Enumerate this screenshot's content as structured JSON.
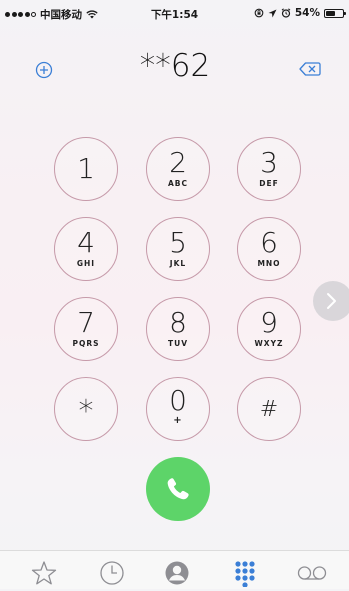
{
  "status_bar": {
    "carrier": "中国移动",
    "time": "下午1:54",
    "battery_percent": "54%",
    "battery_level": 0.54,
    "signal_bars_filled": 4,
    "signal_bars_total": 5,
    "icons": [
      "wifi-icon",
      "lock-rotation-icon",
      "location-icon",
      "alarm-icon"
    ]
  },
  "dialer": {
    "number": "**62",
    "add_contact_icon": "plus-circle-icon",
    "backspace_icon": "backspace-icon"
  },
  "keypad": {
    "keys": [
      {
        "digit": "1",
        "letters": ""
      },
      {
        "digit": "2",
        "letters": "ABC"
      },
      {
        "digit": "3",
        "letters": "DEF"
      },
      {
        "digit": "4",
        "letters": "GHI"
      },
      {
        "digit": "5",
        "letters": "JKL"
      },
      {
        "digit": "6",
        "letters": "MNO"
      },
      {
        "digit": "7",
        "letters": "PQRS"
      },
      {
        "digit": "8",
        "letters": "TUV"
      },
      {
        "digit": "9",
        "letters": "WXYZ"
      },
      {
        "digit": "*",
        "letters": ""
      },
      {
        "digit": "0",
        "letters": "+"
      },
      {
        "digit": "#",
        "letters": ""
      }
    ]
  },
  "call_button_icon": "phone-icon",
  "side_arrow_icon": "chevron-right-icon",
  "colors": {
    "key_border": "#c69aa9",
    "call_green": "#5dd469",
    "accent_blue": "#3b7fd6",
    "tab_gray": "#8e8e93"
  },
  "tab_bar": {
    "tabs": [
      {
        "icon": "star-icon",
        "active": false
      },
      {
        "icon": "clock-icon",
        "active": false
      },
      {
        "icon": "contact-icon",
        "active": false
      },
      {
        "icon": "keypad-icon",
        "active": true
      },
      {
        "icon": "voicemail-icon",
        "active": false
      }
    ]
  }
}
